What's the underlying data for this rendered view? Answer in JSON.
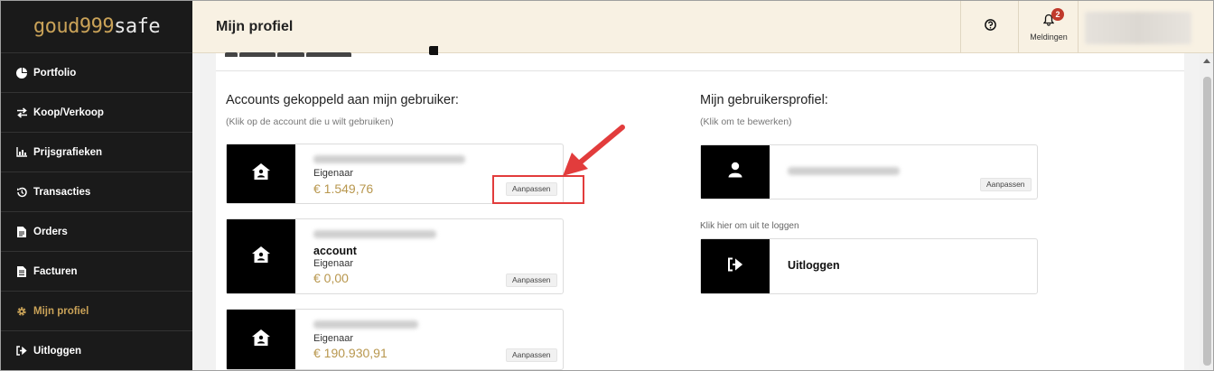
{
  "brand": {
    "logo_main": "goud999",
    "logo_safe": "safe"
  },
  "sidebar": {
    "items": [
      {
        "label": "Portfolio",
        "icon": "pie-chart-icon"
      },
      {
        "label": "Koop/Verkoop",
        "icon": "swap-arrows-icon"
      },
      {
        "label": "Prijsgrafieken",
        "icon": "bar-chart-icon"
      },
      {
        "label": "Transacties",
        "icon": "history-icon"
      },
      {
        "label": "Orders",
        "icon": "document-icon"
      },
      {
        "label": "Facturen",
        "icon": "invoice-icon"
      },
      {
        "label": "Mijn profiel",
        "icon": "gear-icon",
        "active": true
      },
      {
        "label": "Uitloggen",
        "icon": "sign-out-icon"
      }
    ]
  },
  "header": {
    "title": "Mijn profiel",
    "help_icon": "question-circle-icon",
    "notifications": {
      "label": "Meldingen",
      "count": "2",
      "icon": "bell-icon"
    }
  },
  "accounts_section": {
    "title": "Accounts gekoppeld aan mijn gebruiker:",
    "subtitle": "(Klik op de account die u wilt gebruiken)",
    "accounts": [
      {
        "name": "",
        "role": "Eigenaar",
        "balance": "€ 1.549,76",
        "button": "Aanpassen"
      },
      {
        "name": "account",
        "role": "Eigenaar",
        "balance": "€ 0,00",
        "button": "Aanpassen"
      },
      {
        "name": "",
        "role": "Eigenaar",
        "balance": "€ 190.930,91",
        "button": "Aanpassen"
      }
    ]
  },
  "profile_section": {
    "title": "Mijn gebruikersprofiel:",
    "subtitle": "(Klik om te bewerken)",
    "button": "Aanpassen",
    "logout_hint": "Klik hier om uit te loggen",
    "logout_label": "Uitloggen"
  },
  "colors": {
    "gold": "#b8974e",
    "sidebar_bg": "#1a1a1a",
    "header_bg": "#f8f1e3",
    "annotation_red": "#e23c3c"
  }
}
